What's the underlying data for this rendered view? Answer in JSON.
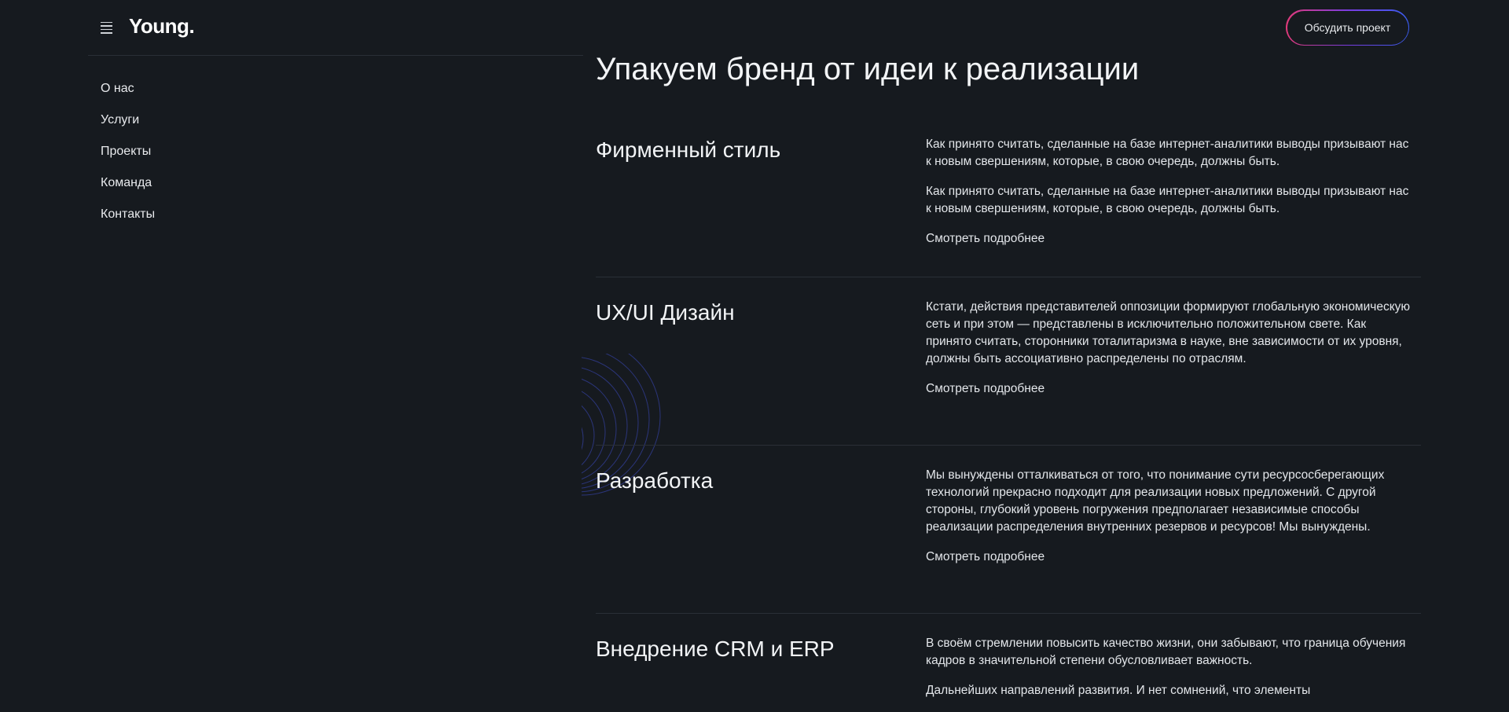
{
  "header": {
    "logo": "Young.",
    "cta_label": "Обсудить проект"
  },
  "sidebar": {
    "items": [
      {
        "label": "О нас"
      },
      {
        "label": "Услуги"
      },
      {
        "label": "Проекты"
      },
      {
        "label": "Команда"
      },
      {
        "label": "Контакты"
      }
    ]
  },
  "main": {
    "title": "Упакуем бренд от идеи к реализации",
    "services": [
      {
        "title": "Фирменный стиль",
        "paragraphs": [
          "Как принято считать, сделанные на базе интернет-аналитики выводы призывают нас к новым свершениям, которые, в свою очередь, должны быть.",
          "Как принято считать, сделанные на базе интернет-аналитики выводы призывают нас к новым свершениям, которые, в свою очередь, должны быть."
        ],
        "more": "Смотреть подробнее"
      },
      {
        "title": "UX/UI Дизайн",
        "paragraphs": [
          "Кстати,  действия представителей оппозиции формируют глобальную экономическую сеть и при этом —  представлены в исключительно положительном свете. Как принято считать, сторонники тоталитаризма в науке, вне зависимости от их уровня, должны быть ассоциативно распределены по отраслям."
        ],
        "more": "Смотреть подробнее"
      },
      {
        "title": "Разработка",
        "paragraphs": [
          "Мы вынуждены отталкиваться от того, что понимание сути ресурсосберегающих технологий прекрасно подходит для реализации новых предложений. С другой стороны, глубокий уровень погружения предполагает независимые способы реализации распределения внутренних резервов и ресурсов! Мы вынуждены."
        ],
        "more": "Смотреть подробнее"
      },
      {
        "title": "Внедрение CRM и ERP",
        "paragraphs": [
          "В своём стремлении повысить качество жизни, они забывают, что граница обучения кадров в значительной степени обусловливает важность.",
          "Дальнейших направлений развития. И нет сомнений, что элементы"
        ],
        "more": ""
      }
    ]
  },
  "colors": {
    "background": "#161a1f",
    "text": "#e8eaed",
    "divider": "#2a2f36",
    "cta_gradient_start": "#e23a7a",
    "cta_gradient_end": "#3a5df0"
  },
  "icons": {
    "menu": "hamburger-menu-icon",
    "decor": "concentric-arcs-decoration"
  }
}
